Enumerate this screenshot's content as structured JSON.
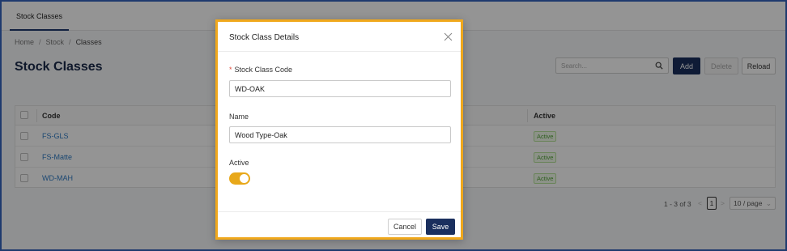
{
  "tabs": [
    {
      "label": "Stock Classes",
      "active": true
    }
  ],
  "breadcrumb": [
    "Home",
    "Stock",
    "Classes"
  ],
  "page_title": "Stock Classes",
  "search": {
    "placeholder": "Search...",
    "value": ""
  },
  "toolbar": {
    "add_label": "Add",
    "delete_label": "Delete",
    "reload_label": "Reload"
  },
  "table": {
    "headers": {
      "code": "Code",
      "active": "Active"
    },
    "rows": [
      {
        "code": "FS-GLS",
        "status": "Active"
      },
      {
        "code": "FS-Matte",
        "status": "Active"
      },
      {
        "code": "WD-MAH",
        "status": "Active"
      }
    ]
  },
  "pagination": {
    "range": "1 - 3 of 3",
    "current_page": "1",
    "page_size": "10 / page",
    "prev": "<",
    "next": ">"
  },
  "modal": {
    "title": "Stock Class Details",
    "code_label": "Stock Class Code",
    "code_value": "WD-OAK",
    "name_label": "Name",
    "name_value": "Wood Type-Oak",
    "active_label": "Active",
    "active_on": true,
    "cancel_label": "Cancel",
    "save_label": "Save"
  },
  "colors": {
    "brand": "#1a2f5e",
    "toggle": "#e8a81a",
    "modal_border": "#f0a81c",
    "link": "#2f7bc4",
    "tag_green": "#52a33a"
  }
}
